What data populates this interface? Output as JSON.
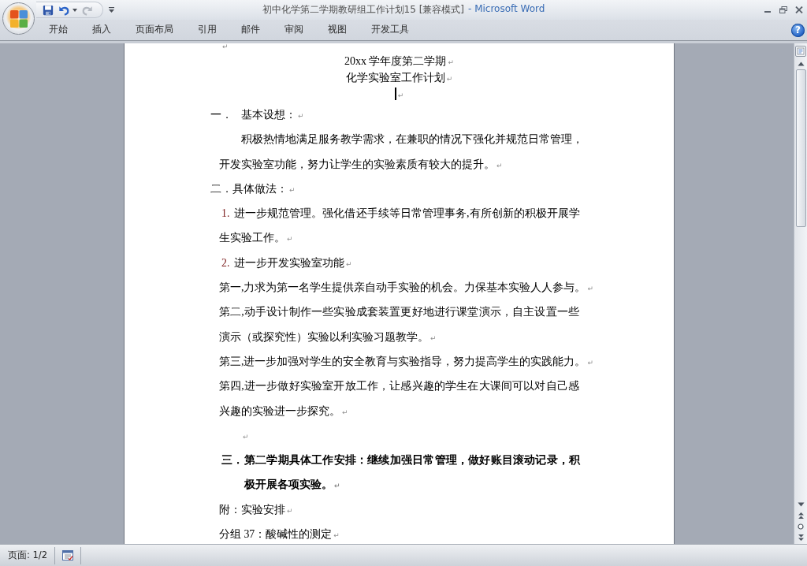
{
  "window": {
    "document_name": "初中化学第二学期教研组工作计划15 [兼容模式]",
    "app_name": "- Microsoft Word"
  },
  "quick_access": [
    {
      "kind": "save",
      "disabled": false
    },
    {
      "kind": "undo",
      "disabled": false
    },
    {
      "kind": "redo",
      "disabled": true
    }
  ],
  "ribbon": {
    "tabs": [
      {
        "label": "开始",
        "selected": false
      },
      {
        "label": "插入",
        "selected": false
      },
      {
        "label": "页面布局",
        "selected": false
      },
      {
        "label": "引用",
        "selected": false
      },
      {
        "label": "邮件",
        "selected": false
      },
      {
        "label": "审阅",
        "selected": false
      },
      {
        "label": "视图",
        "selected": false
      },
      {
        "label": "开发工具",
        "selected": false
      }
    ],
    "help": "?"
  },
  "document": {
    "blocks": [
      {
        "kind": "empty",
        "mark": "↵"
      },
      {
        "kind": "title",
        "text": "20xx 学年度第二学期",
        "mark": "↵"
      },
      {
        "kind": "title",
        "text": "化学实验室工作计划",
        "mark": "↵"
      },
      {
        "kind": "cursor",
        "mark": "↵"
      },
      {
        "kind": "heading",
        "number": "一．",
        "text": "基本设想：",
        "mark": "↵"
      },
      {
        "kind": "indented",
        "lines": [
          "积极热情地满足服务教学需求，在兼职的情况下强化并规范日常管理，",
          "开发实验室功能，努力让学生的实验素质有较大的提升。"
        ],
        "mark": "↵"
      },
      {
        "kind": "heading",
        "text": "二．具体做法：",
        "mark": "↵"
      },
      {
        "kind": "numbered",
        "number": "1.",
        "lines": [
          "进一步规范管理。强化借还手续等日常管理事务,有所创新的积极开展学",
          "生实验工作。"
        ],
        "mark": "↵"
      },
      {
        "kind": "numbered",
        "number": "2.",
        "lines": [
          "进一步开发实验室功能"
        ],
        "mark": "↵"
      },
      {
        "kind": "body",
        "lines": [
          "第一,力求为第一名学生提供亲自动手实验的机会。力保基本实验人人参与。"
        ],
        "mark": "↵"
      },
      {
        "kind": "body",
        "lines": [
          "第二,动手设计制作一些实验成套装置更好地进行课堂演示，自主设置一些",
          "演示（或探究性）实验以利实验习题教学。"
        ],
        "mark": "↵"
      },
      {
        "kind": "body",
        "lines": [
          "第三,进一步加强对学生的安全教育与实验指导，努力提高学生的实践能力。"
        ],
        "mark": "↵"
      },
      {
        "kind": "body",
        "lines": [
          "第四,进一步做好实验室开放工作，让感兴趣的学生在大课间可以对自己感",
          "兴趣的实验进一步探究。"
        ],
        "mark": "↵"
      },
      {
        "kind": "empty_indented",
        "mark": "↵"
      },
      {
        "kind": "bold_heading",
        "number": "三．",
        "lines": [
          "第二学期具体工作安排：继续加强日常管理，做好账目滚动记录，积",
          "极开展各项实验。"
        ],
        "mark": "↵"
      },
      {
        "kind": "body",
        "lines": [
          "附：实验安排"
        ],
        "mark": "↵"
      },
      {
        "kind": "body",
        "lines": [
          "分组 37：酸碱性的测定"
        ],
        "mark": "↵"
      }
    ]
  },
  "status_bar": {
    "page": "页面: 1/2"
  }
}
